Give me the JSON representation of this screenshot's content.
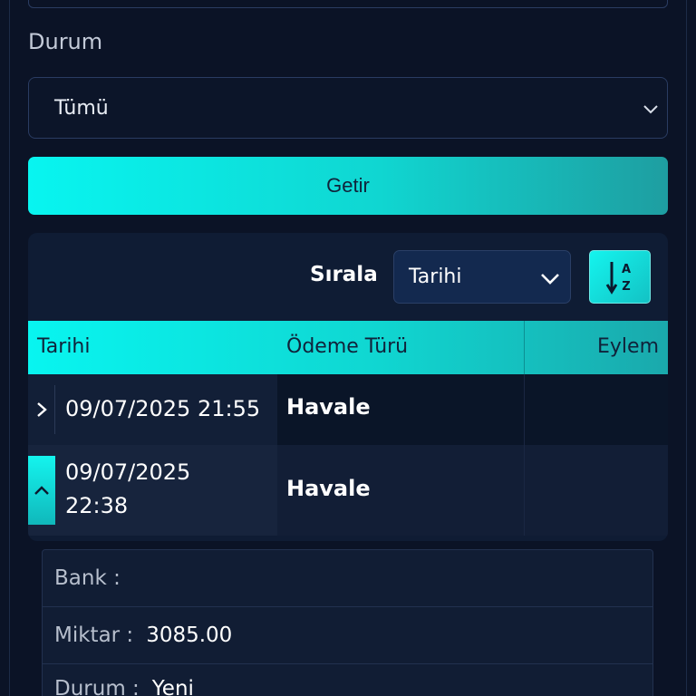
{
  "filter": {
    "status_label": "Durum",
    "status_value": "Tümü",
    "fetch_label": "Getir"
  },
  "sort": {
    "label": "Sırala",
    "value": "Tarihi"
  },
  "table": {
    "headers": [
      "Tarihi",
      "Ödeme Türü",
      "Eylem"
    ],
    "rows": [
      {
        "date": "09/07/2025 21:55",
        "payment_type": "Havale",
        "expanded": false
      },
      {
        "date_line1": "09/07/2025",
        "date_line2": "22:38",
        "payment_type": "Havale",
        "expanded": true
      }
    ]
  },
  "details": {
    "bank_key": "Bank",
    "bank_value": "",
    "amount_key": "Miktar",
    "amount_value": "3085.00",
    "status_key": "Durum",
    "status_value": "Yeni"
  },
  "colors": {
    "background": "#0b1326",
    "accent": "#08f5f0",
    "card": "#0f1c34"
  }
}
